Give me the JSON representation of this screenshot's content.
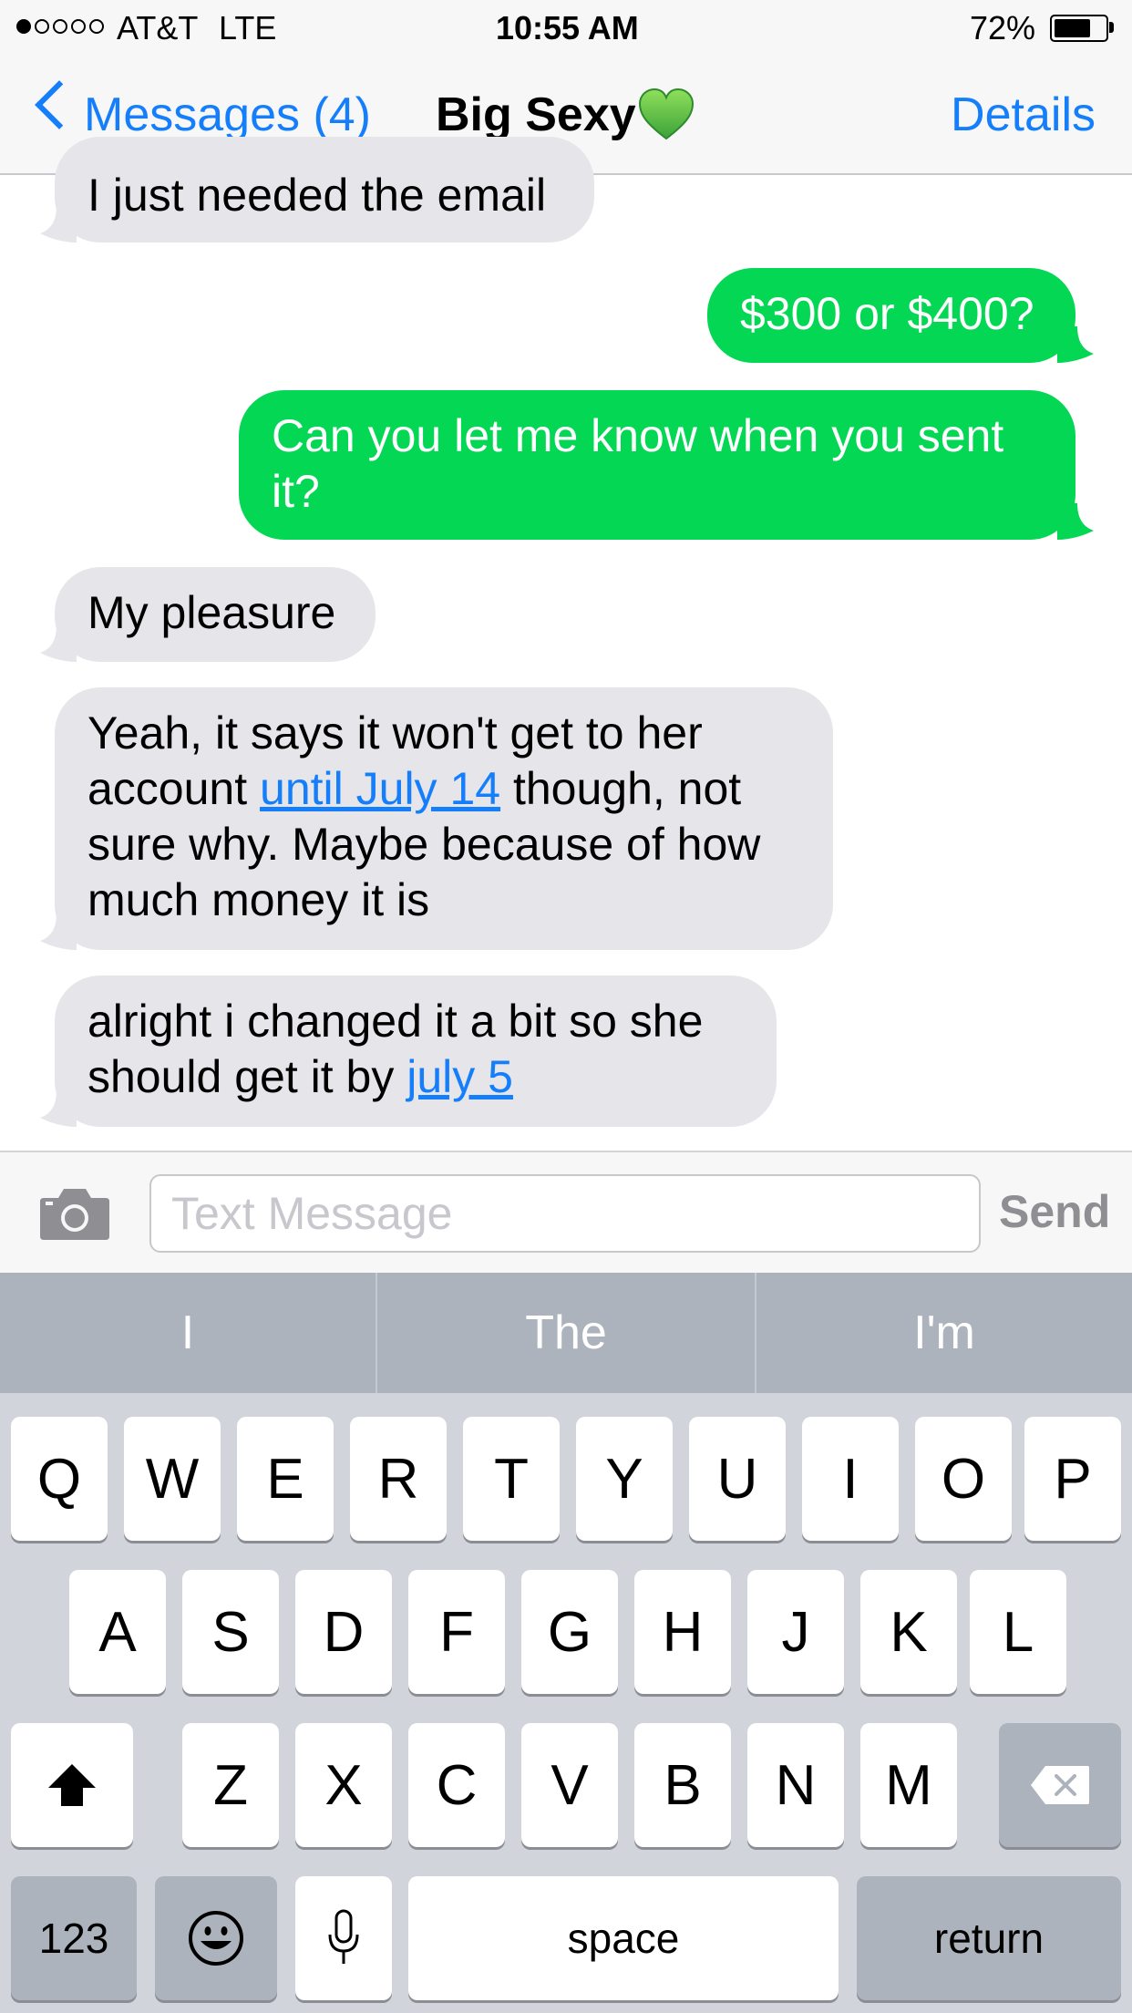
{
  "status_bar": {
    "carrier": "AT&T",
    "network": "LTE",
    "time": "10:55 AM",
    "battery": "72%",
    "battery_level": 0.72,
    "signal_bars": 1
  },
  "nav": {
    "back_label": "Messages (4)",
    "title": "Big Sexy",
    "title_icon": "green-heart-icon",
    "details_label": "Details"
  },
  "messages": [
    {
      "dir": "incoming",
      "text": "I just needed the email"
    },
    {
      "dir": "outgoing",
      "text": "$300 or $400?"
    },
    {
      "dir": "outgoing",
      "text": "Can you let me know when you sent it?"
    },
    {
      "dir": "incoming",
      "text": "My pleasure"
    },
    {
      "dir": "incoming",
      "before": "Yeah, it says it won't get to her account ",
      "link": "until July 14",
      "after": " though, not sure why. Maybe because of how much money it is"
    },
    {
      "dir": "incoming",
      "before": "alright i changed it a bit so she should get it by ",
      "link": "july 5",
      "after": ""
    }
  ],
  "input": {
    "placeholder": "Text Message",
    "send_label": "Send",
    "camera_icon": "camera-icon"
  },
  "keyboard": {
    "predictions": [
      "I",
      "The",
      "I'm"
    ],
    "row1": [
      "Q",
      "W",
      "E",
      "R",
      "T",
      "Y",
      "U",
      "I",
      "O",
      "P"
    ],
    "row2": [
      "A",
      "S",
      "D",
      "F",
      "G",
      "H",
      "J",
      "K",
      "L"
    ],
    "row3": [
      "Z",
      "X",
      "C",
      "V",
      "B",
      "N",
      "M"
    ],
    "numbers_label": "123",
    "space_label": "space",
    "return_label": "return",
    "shift_icon": "shift-arrow-icon",
    "delete_icon": "backspace-icon",
    "emoji_icon": "emoji-icon",
    "mic_icon": "microphone-icon"
  },
  "colors": {
    "accent": "#157efb",
    "outgoing_bubble": "#04d754",
    "incoming_bubble": "#e5e5ea",
    "keyboard_bg": "#d1d5db"
  }
}
